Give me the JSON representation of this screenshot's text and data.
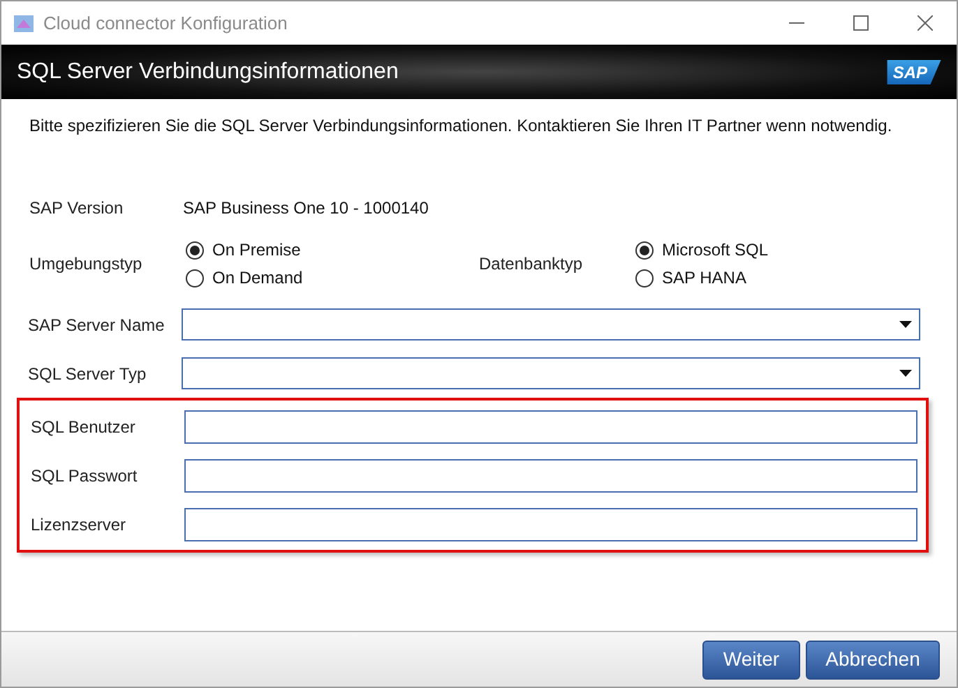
{
  "window": {
    "title": "Cloud connector Konfiguration"
  },
  "header": {
    "title": "SQL Server Verbindungsinformationen",
    "logo": "SAP"
  },
  "description": "Bitte spezifizieren Sie die SQL Server Verbindungsinformationen. Kontaktieren Sie Ihren IT Partner wenn notwendig.",
  "version": {
    "label": "SAP Version",
    "value": "SAP Business One 10 - 1000140"
  },
  "radio_groups": [
    {
      "label": "Umgebungstyp",
      "options": [
        {
          "label": "On Premise",
          "selected": true
        },
        {
          "label": "On Demand",
          "selected": false
        }
      ]
    },
    {
      "label": "Datenbanktyp",
      "options": [
        {
          "label": "Microsoft SQL",
          "selected": true
        },
        {
          "label": "SAP HANA",
          "selected": false
        }
      ]
    }
  ],
  "dropdowns": [
    {
      "label": "SAP Server Name"
    },
    {
      "label": "SQL Server Typ"
    }
  ],
  "highlighted_fields": [
    {
      "label": "SQL Benutzer"
    },
    {
      "label": "SQL Passwort"
    },
    {
      "label": "Lizenzserver"
    }
  ],
  "buttons": [
    "Weiter",
    "Abbrechen"
  ]
}
